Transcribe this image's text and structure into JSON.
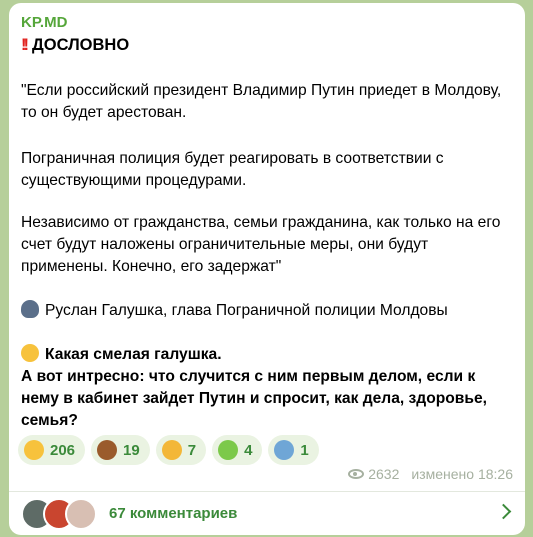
{
  "message": {
    "channel": "KP.MD",
    "title_prefix": "‼️",
    "title": "ДОСЛОВНО",
    "paragraphs": [
      "\"Если российский президент Владимир Путин приедет в Молдову, то он будет арестован.",
      "Пограничная полиция будет реагировать в соответствии с существующими процедурами.",
      "Независимо от гражданства, семьи гражданина, как только на его счет будут наложены ограничительные меры, они будут применены. Конечно, его задержат\""
    ],
    "attribution": "Руслан Галушка, глава Пограничной полиции Молдовы",
    "comment_line1": "Какая смелая галушка.",
    "comment_line2": "А вот интресно: что случится с ним первым делом, если к нему в кабинет зайдет Путин и спросит, как дела, здоровье, семья?"
  },
  "reactions": [
    {
      "icon": "grinning-face-icon",
      "count": "206"
    },
    {
      "icon": "pile-of-poo-icon",
      "count": "19"
    },
    {
      "icon": "thumbs-up-icon",
      "count": "7"
    },
    {
      "icon": "nauseated-face-icon",
      "count": "4"
    },
    {
      "icon": "screaming-face-icon",
      "count": "1"
    }
  ],
  "meta": {
    "views": "2632",
    "edited_time": "изменено 18:26"
  },
  "comments": {
    "label": "67 комментариев"
  },
  "colors": {
    "background": "#b6cf9a",
    "accent": "#3b8a3a",
    "channel": "#55a63a"
  }
}
